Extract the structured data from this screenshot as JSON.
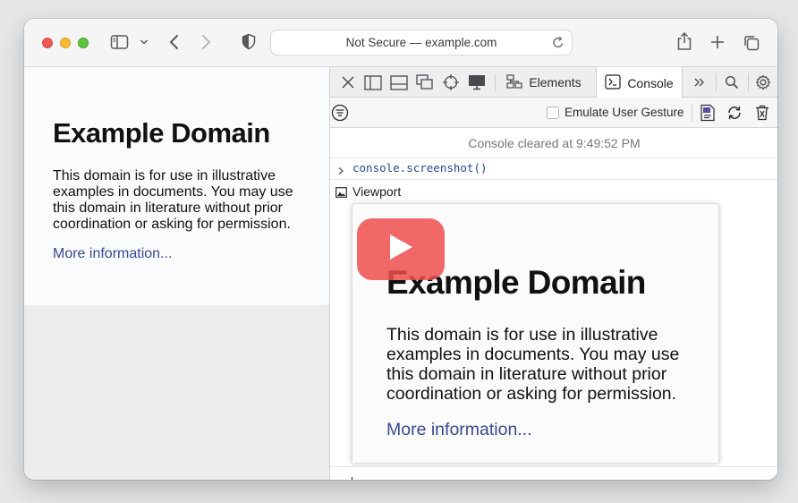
{
  "toolbar": {
    "address": "Not Secure — example.com",
    "icons": [
      "sidebar-toggle-icon",
      "chevron-down-icon",
      "back-arrow-icon",
      "forward-arrow-icon",
      "privacy-shield-icon",
      "reload-icon",
      "share-icon",
      "new-tab-plus-icon",
      "tab-overview-icon"
    ]
  },
  "page": {
    "heading": "Example Domain",
    "body": "This domain is for use in illustrative examples in documents. You may use this domain in literature without prior coordination or asking for permission.",
    "link": "More information..."
  },
  "devtools": {
    "tabs": {
      "elements": "Elements",
      "console": "Console"
    },
    "emulate_label": "Emulate User Gesture",
    "cleared_message": "Console cleared at 9:49:52 PM",
    "command": "console.screenshot()",
    "viewport_label": "Viewport",
    "screenshot": {
      "heading": "Example Domain",
      "body": "This domain is for use in illustrative examples in documents. You may use this domain in literature without prior coordination or asking for permission.",
      "link": "More information..."
    },
    "prompt_value": ""
  },
  "colors": {
    "accent_link": "#38488f",
    "console_command": "#1f4a8c",
    "play_button": "#ef4e4e"
  }
}
